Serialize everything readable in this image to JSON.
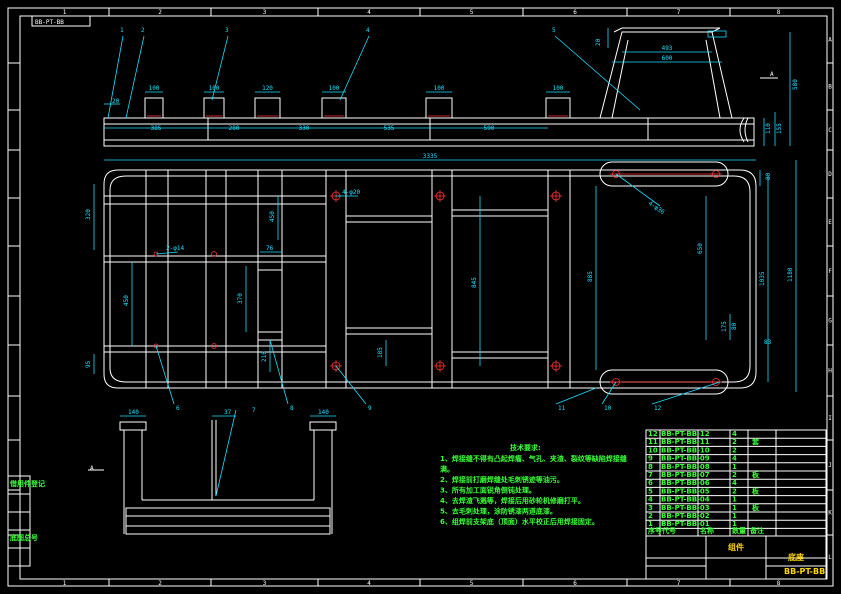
{
  "drawing": {
    "title_tag": "BB-PT-BB",
    "columns": [
      "1",
      "2",
      "3",
      "4",
      "5",
      "6",
      "7",
      "8"
    ],
    "rows": [
      "A",
      "B",
      "C",
      "D",
      "E",
      "F",
      "G",
      "H",
      "I",
      "J",
      "K",
      "L"
    ],
    "balloons": [
      "1",
      "2",
      "3",
      "4",
      "5",
      "6",
      "7",
      "8",
      "9",
      "10",
      "11",
      "12"
    ],
    "top_dims": {
      "d100a": "100",
      "d100b": "100",
      "d120": "120",
      "d100c": "100",
      "d100d": "100",
      "d100e": "100",
      "d20": "20",
      "d385": "385",
      "d280": "280",
      "d330": "330",
      "d535": "535",
      "d590": "590",
      "d493": "493",
      "d600": "600",
      "d20b": "20",
      "d580": "580",
      "d110": "110",
      "d155": "155",
      "dA": "A"
    },
    "plan_dims": {
      "overall": "3335",
      "d320": "320",
      "d450": "450",
      "d95": "95",
      "d450b": "450",
      "d370": "370",
      "d76": "76",
      "d210": "210",
      "d185": "185",
      "d845": "845",
      "d885": "885",
      "d650": "650",
      "d1035": "1035",
      "d1180": "1180",
      "d80": "80",
      "d175": "175",
      "d80b": "80",
      "d83": "83",
      "hole_a": "4-φ20",
      "hole_b": "2-φ14",
      "hole_c": "4-φ36"
    },
    "section_dims": {
      "d140a": "140",
      "d37": "37",
      "d140b": "140"
    },
    "notes_title": "技术要求:",
    "notes": [
      "1、焊接缝不得有凸起焊瘤、气孔、夹渣、裂纹等缺陷焊接缝",
      "   满。",
      "2、焊接前打磨焊缝处毛刺锈迹等油污。",
      "3、所有加工面锐角倒钝处理。",
      "4、去焊渣飞溅等，焊接后用砂轮机修磨打平。",
      "5、去毛刺处理，涂防锈漆两道底漆。",
      "6、组焊前支架底（顶面）水平校正后用焊接固定。"
    ],
    "bom_rows": [
      [
        "12",
        "BB-PT-BB-12",
        "",
        "4",
        ""
      ],
      [
        "11",
        "BB-PT-BB-11",
        "",
        "2",
        "套"
      ],
      [
        "10",
        "BB-PT-BB-10",
        "",
        "2",
        ""
      ],
      [
        "9",
        "BB-PT-BB-09",
        "",
        "4",
        ""
      ],
      [
        "8",
        "BB-PT-BB-08",
        "",
        "1",
        ""
      ],
      [
        "7",
        "BB-PT-BB-07",
        "",
        "2",
        "板"
      ],
      [
        "6",
        "BB-PT-BB-06",
        "",
        "4",
        ""
      ],
      [
        "5",
        "BB-PT-BB-05",
        "",
        "2",
        "板"
      ],
      [
        "4",
        "BB-PT-BB-04",
        "",
        "1",
        ""
      ],
      [
        "3",
        "BB-PT-BB-03",
        "",
        "1",
        "板"
      ],
      [
        "2",
        "BB-PT-BB-02",
        "",
        "1",
        ""
      ],
      [
        "1",
        "BB-PT-BB-01",
        "",
        "1",
        ""
      ]
    ],
    "bom_head": [
      "序号",
      "代号",
      "名称",
      "数量",
      "备注"
    ],
    "title_block": {
      "name": "组件",
      "material": "底座",
      "code": "BB-PT-BB"
    },
    "left_block": [
      "借用件登记",
      "",
      "",
      "底图总号",
      ""
    ]
  }
}
